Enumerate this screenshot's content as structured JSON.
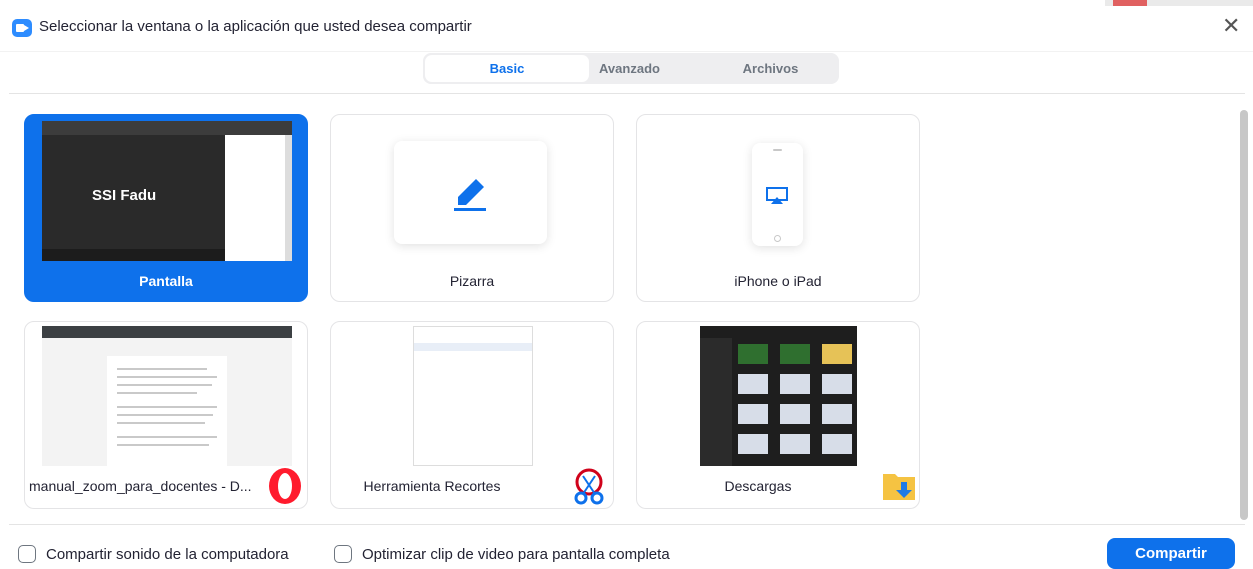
{
  "window": {
    "title": "Seleccionar la ventana o la aplicación que usted desea compartir"
  },
  "tabs": [
    {
      "label": "Basic",
      "active": true
    },
    {
      "label": "Avanzado",
      "active": false
    },
    {
      "label": "Archivos",
      "active": false
    }
  ],
  "cards": [
    {
      "label": "Pantalla",
      "selected": true,
      "thumb_text": "SSI Fadu"
    },
    {
      "label": "Pizarra",
      "selected": false,
      "icon": "pen-icon"
    },
    {
      "label": "iPhone o iPad",
      "selected": false,
      "icon": "airplay-icon"
    },
    {
      "label": "manual_zoom_para_docentes - D...",
      "selected": false,
      "app_icon": "opera-icon"
    },
    {
      "label": "Herramienta Recortes",
      "selected": false,
      "app_icon": "scissors-icon"
    },
    {
      "label": "Descargas",
      "selected": false,
      "app_icon": "folder-download-icon"
    }
  ],
  "options": {
    "share_sound": {
      "label": "Compartir sonido de la computadora",
      "checked": false
    },
    "optimize_video": {
      "label": "Optimizar clip de video para pantalla completa",
      "checked": false
    }
  },
  "actions": {
    "share_label": "Compartir"
  },
  "colors": {
    "accent": "#0e71eb",
    "border": "#e4e4e6",
    "text": "#232333"
  }
}
